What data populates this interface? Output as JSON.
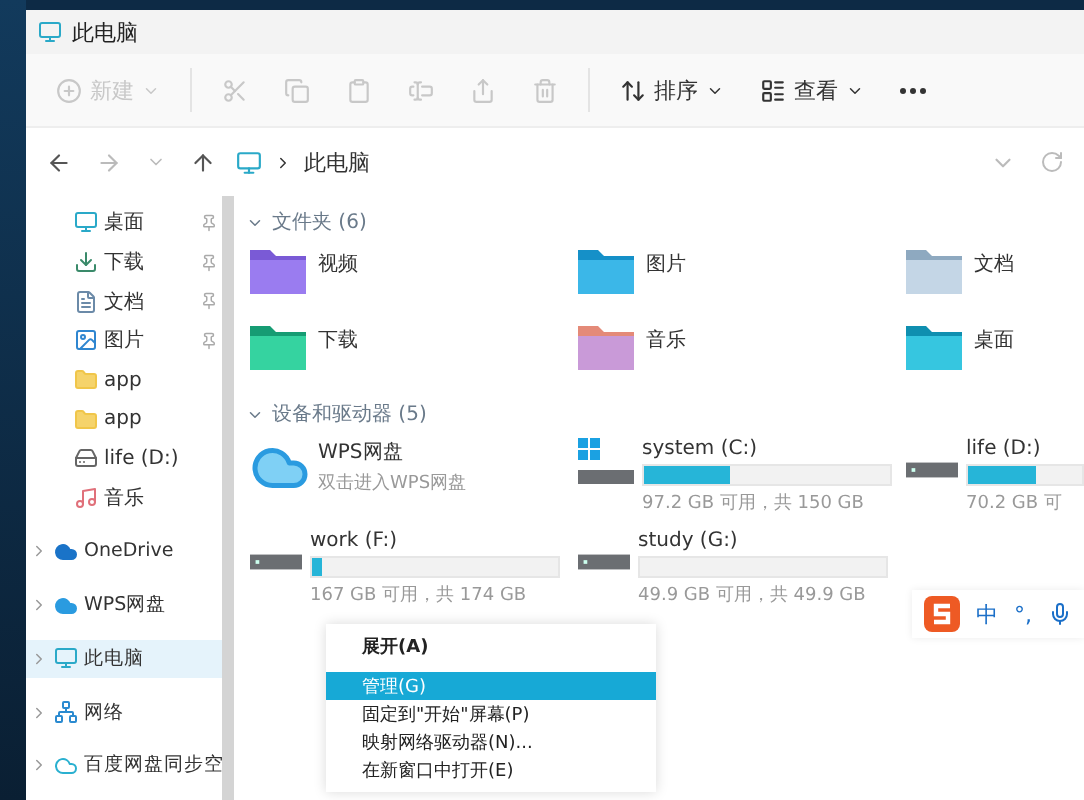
{
  "window": {
    "title": "此电脑"
  },
  "toolbar": {
    "new": {
      "label": "新建",
      "disabled": true
    },
    "actions": [
      {
        "disabled": true
      },
      {
        "disabled": true
      },
      {
        "disabled": true
      },
      {
        "disabled": true
      },
      {
        "disabled": true
      },
      {
        "disabled": true
      }
    ],
    "sort": "排序",
    "view": "查看"
  },
  "address": {
    "path": "此电脑"
  },
  "sidebar": {
    "quick_access": [
      {
        "label": "桌面",
        "pinned": true,
        "selected": false
      },
      {
        "label": "下载",
        "pinned": true,
        "selected": false
      },
      {
        "label": "文档",
        "pinned": true,
        "selected": false
      },
      {
        "label": "图片",
        "pinned": true,
        "selected": false
      },
      {
        "label": "app",
        "pinned": false,
        "selected": false
      },
      {
        "label": "app",
        "pinned": false,
        "selected": false
      },
      {
        "label": "life (D:)",
        "pinned": false,
        "selected": false
      },
      {
        "label": "音乐",
        "pinned": false,
        "selected": false
      }
    ],
    "locations": [
      {
        "label": "OneDrive",
        "expanded": false,
        "selected": false
      },
      {
        "label": "WPS网盘",
        "expanded": false,
        "selected": false
      },
      {
        "label": "此电脑",
        "expanded": false,
        "selected": true
      },
      {
        "label": "网络",
        "expanded": false,
        "selected": false
      },
      {
        "label": "百度网盘同步空",
        "expanded": false,
        "selected": false
      }
    ]
  },
  "folders_section": {
    "title": "文件夹 (6)",
    "expanded": true,
    "items": [
      {
        "name": "视频"
      },
      {
        "name": "图片"
      },
      {
        "name": "文档"
      },
      {
        "name": "下载"
      },
      {
        "name": "音乐"
      },
      {
        "name": "桌面"
      }
    ]
  },
  "drives_section": {
    "title": "设备和驱动器 (5)",
    "expanded": true,
    "items": [
      {
        "kind": "cloud",
        "name": "WPS网盘",
        "detail": "双击进入WPS网盘"
      },
      {
        "kind": "system",
        "name": "system (C:)",
        "level": 0.35,
        "detail": "97.2 GB 可用，共 150 GB"
      },
      {
        "kind": "drive",
        "name": "life (D:)",
        "level": 0.6,
        "detail": "70.2 GB 可"
      },
      {
        "kind": "drive",
        "name": "work (F:)",
        "level": 0.04,
        "detail": "167 GB 可用，共 174 GB"
      },
      {
        "kind": "drive",
        "name": "study (G:)",
        "level": 0,
        "detail": "49.9 GB 可用，共 49.9 GB"
      }
    ]
  },
  "context_menu": [
    {
      "label": "展开(A)",
      "bold": true,
      "selected": false
    },
    {
      "label": "管理(G)",
      "bold": false,
      "selected": true
    },
    {
      "label": "固定到\"开始\"屏幕(P)",
      "bold": false,
      "selected": false
    },
    {
      "label": "映射网络驱动器(N)...",
      "bold": false,
      "selected": false
    },
    {
      "label": "在新窗口中打开(E)",
      "bold": false,
      "selected": false
    }
  ],
  "ime_bar": {
    "mode": "中",
    "punctuation": "°,"
  }
}
